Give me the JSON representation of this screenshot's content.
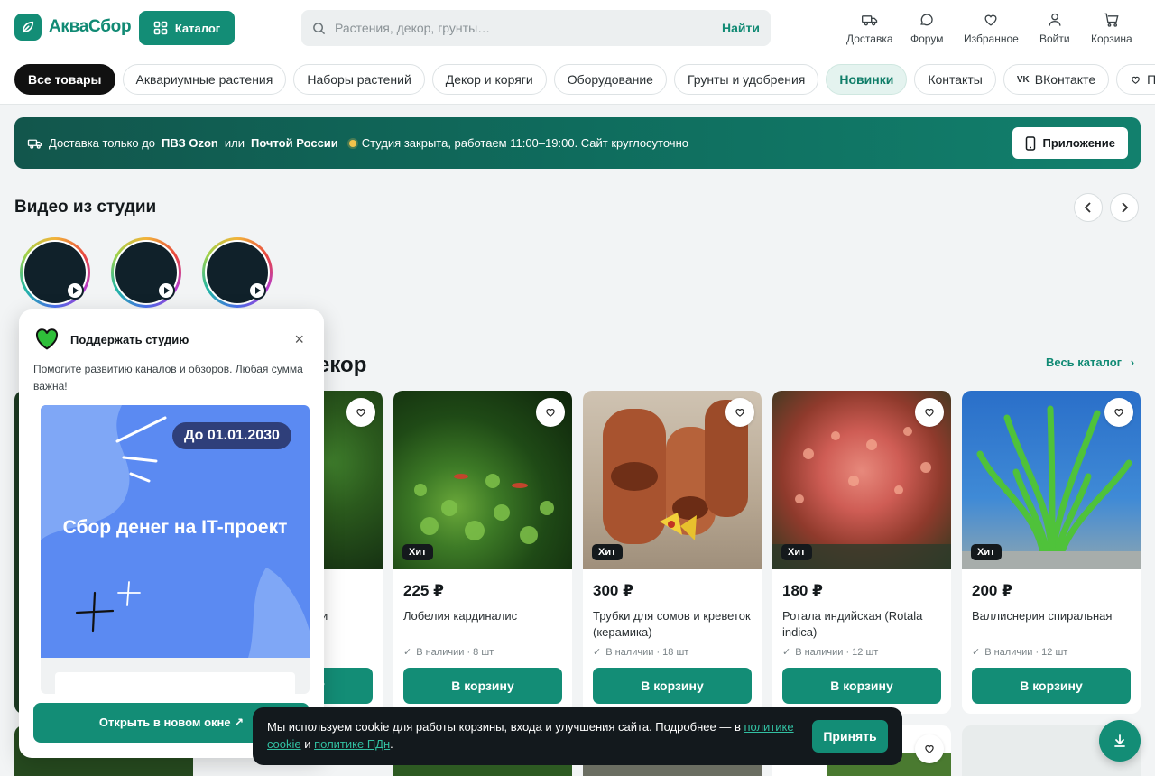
{
  "brand": {
    "name": "АкваСбор",
    "accent": "#138d76"
  },
  "header": {
    "catalog_label": "Каталог",
    "search_placeholder": "Растения, декор, грунты…",
    "search_button": "Найти",
    "nav": [
      {
        "label": "Доставка",
        "icon": "truck-icon"
      },
      {
        "label": "Форум",
        "icon": "chat-icon"
      },
      {
        "label": "Избранное",
        "icon": "heart-icon"
      },
      {
        "label": "Войти",
        "icon": "user-icon"
      },
      {
        "label": "Корзина",
        "icon": "cart-icon"
      }
    ]
  },
  "categories": [
    "Все товары",
    "Аквариумные растения",
    "Наборы растений",
    "Декор и коряги",
    "Оборудование",
    "Грунты и удобрения",
    "Новинки",
    "Контакты",
    "ВКонтакте",
    "Подд"
  ],
  "banner": {
    "text_prefix": "Доставка только до",
    "ozon": "ПВЗ Ozon",
    "or": "или",
    "post": "Почтой России",
    "status": "Студия закрыта, работаем 11:00–19:00. Сайт круглосуточно",
    "app_button": "Приложение"
  },
  "videos": {
    "title": "Видео из студии"
  },
  "products_section": {
    "title_fragment": "екор",
    "all_link": "Весь каталог"
  },
  "products": [
    {
      "price": "225 ₽",
      "name": "Лобелия кардиналис",
      "stock": "В наличии · 8 шт",
      "badge": "Хит",
      "cart": "В корзину"
    },
    {
      "price": "300 ₽",
      "name": "Трубки для сомов и креветок (керамика)",
      "stock": "В наличии · 18 шт",
      "badge": "Хит",
      "cart": "В корзину"
    },
    {
      "price": "180 ₽",
      "name": "Ротала индийская (Rotala indica)",
      "stock": "В наличии · 12 шт",
      "badge": "Хит",
      "cart": "В корзину"
    },
    {
      "price": "200 ₽",
      "name": "Валлиснерия спиральная",
      "stock": "В наличии · 12 шт",
      "badge": "Хит",
      "cart": "В корзину"
    }
  ],
  "partial_card": {
    "name_fragment": "и",
    "cart": "В корзину"
  },
  "support": {
    "title": "Поддержать студию",
    "text": "Помогите развитию каналов и обзоров. Любая сумма важна!",
    "date_badge": "До 01.01.2030",
    "goal": "Сбор денег на IT-проект",
    "open_button": "Открыть в новом окне ↗"
  },
  "cookie": {
    "text_before": "Мы используем cookie для работы корзины, входа и улучшения сайта. Подробнее — в",
    "link1": "политике cookie",
    "and": "и",
    "link2": "политике ПДн",
    "end": ".",
    "accept": "Принять"
  }
}
